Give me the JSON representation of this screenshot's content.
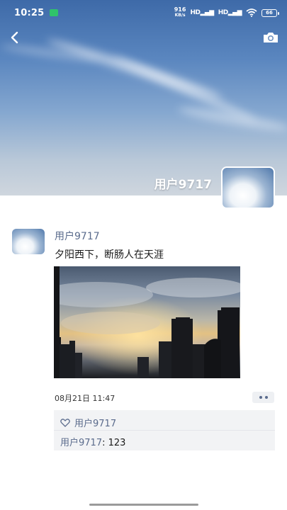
{
  "status_bar": {
    "time": "10:25",
    "net_speed_value": "916",
    "net_speed_unit": "KB/s",
    "signal_1": "HD",
    "signal_2": "HD",
    "battery": "66"
  },
  "cover": {
    "username": "用户9717"
  },
  "post": {
    "username": "用户9717",
    "text": "夕阳西下，断肠人在天涯",
    "time": "08月21日 11:47",
    "likes": {
      "names": "用户9717"
    },
    "comments": [
      {
        "author": "用户9717",
        "separator": ": ",
        "text": "123"
      }
    ]
  },
  "colors": {
    "link": "#5a6b8c",
    "panel": "#f2f3f5"
  }
}
